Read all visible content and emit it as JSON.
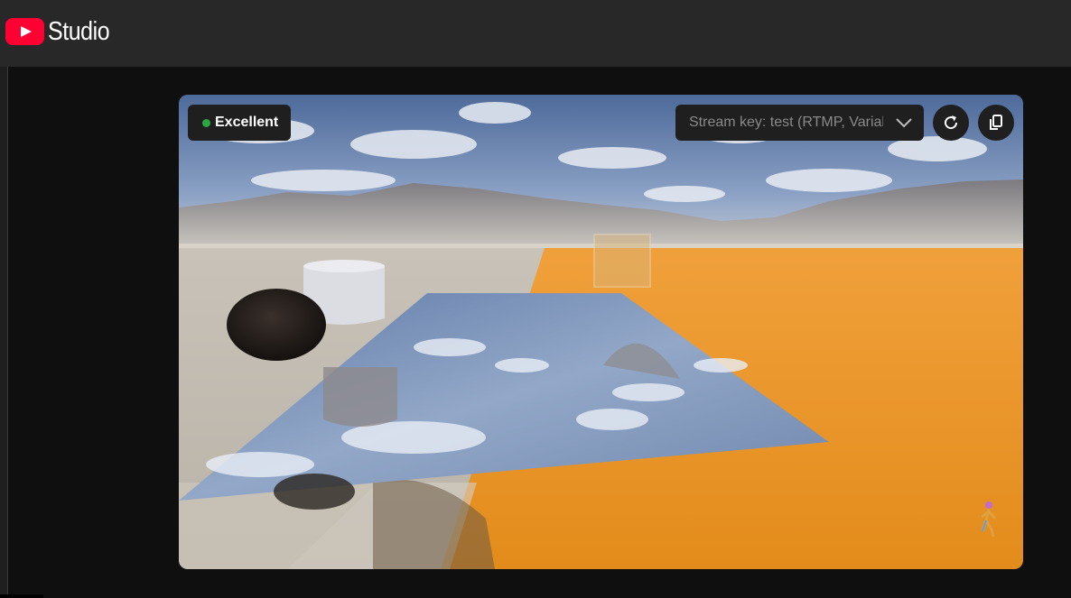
{
  "app": {
    "logo_icon": "youtube-play-icon",
    "name": "Studio",
    "brand_color": "#ff0033"
  },
  "preview": {
    "health_label": "Excellent",
    "health_color": "#2ba640",
    "stream_key_label": "Stream key: test (RTMP, Variable)",
    "dropdown_icon": "chevron-down-icon",
    "refresh_icon": "refresh-icon",
    "copy_icon": "copy-icon",
    "overlay_icon": "character-figure-icon",
    "scene_description": "3D game scene with desert mountains, sky, orange floor, reflective plane, sphere, cylinder"
  }
}
